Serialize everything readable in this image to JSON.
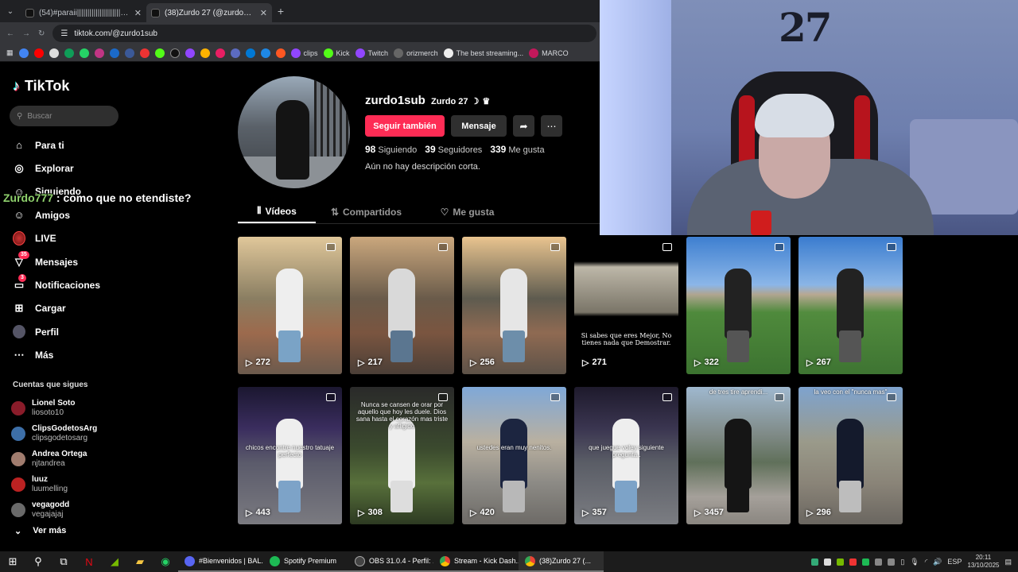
{
  "browser": {
    "tabs": [
      {
        "title": "(54)#paraii||||||||||||||||||||||||||||| #ti",
        "active": false
      },
      {
        "title": "(38)Zurdo 27 (@zurdo1sub",
        "active": true
      }
    ],
    "url": "tiktok.com/@zurdo1sub",
    "bookmarks": [
      "clips",
      "Kick",
      "Twitch",
      "orizmerch",
      "The best streaming...",
      "MARCO"
    ]
  },
  "tiktok": {
    "brand": "TikTok",
    "search_placeholder": "Buscar",
    "nav": [
      {
        "label": "Para ti",
        "icon": "home-icon"
      },
      {
        "label": "Explorar",
        "icon": "compass-icon"
      },
      {
        "label": "Siguiendo",
        "icon": "following-icon"
      },
      {
        "label": "Amigos",
        "icon": "friends-icon"
      },
      {
        "label": "LIVE",
        "icon": "live-icon"
      },
      {
        "label": "Mensajes",
        "icon": "messages-icon",
        "badge": "35"
      },
      {
        "label": "Notificaciones",
        "icon": "inbox-icon",
        "badge": "3"
      },
      {
        "label": "Cargar",
        "icon": "upload-icon"
      },
      {
        "label": "Perfil",
        "icon": "profile-icon"
      },
      {
        "label": "Más",
        "icon": "more-icon"
      }
    ],
    "following_header": "Cuentas que sigues",
    "following": [
      {
        "name": "Lionel Soto",
        "handle": "liosoto10",
        "color": "#8a1c2a"
      },
      {
        "name": "ClipsGodetosArg",
        "handle": "clipsgodetosarg",
        "color": "#3d6fa8"
      },
      {
        "name": "Andrea Ortega",
        "handle": "njtandrea",
        "color": "#a07c6e"
      },
      {
        "name": "luuz",
        "handle": "luumelling",
        "color": "#b22"
      },
      {
        "name": "vegagodd",
        "handle": "vegajajaj",
        "color": "#6a6a6a"
      }
    ],
    "ver_mas": "Ver más"
  },
  "chat_overlay": {
    "user": "Zurdo777",
    "message": " : como que no etendiste?"
  },
  "profile": {
    "username": "zurdo1sub",
    "nickname": "Zurdo 27",
    "follow_label": "Seguir también",
    "message_label": "Mensaje",
    "stats": [
      {
        "value": "98",
        "label": "Siguiendo"
      },
      {
        "value": "39",
        "label": "Seguidores"
      },
      {
        "value": "339",
        "label": "Me gusta"
      }
    ],
    "bio": "Aún no hay descripción corta.",
    "tabs": [
      "Vídeos",
      "Compartidos",
      "Me gusta"
    ]
  },
  "videos": [
    {
      "views": "272",
      "caption": "",
      "bg": "linear-gradient(180deg,#e0c79a 0%,#8a7e62 45%,#9c6a4d 70%,#6b5a4d 100%)",
      "fig": "#eee",
      "legs": "#7aa3c6"
    },
    {
      "views": "217",
      "caption": "",
      "bg": "linear-gradient(180deg,#caa77d 0%,#6a5b4a 45%,#7a5540 70%,#4b3f37 100%)",
      "fig": "#d9d9d9",
      "legs": "#5b7690"
    },
    {
      "views": "256",
      "caption": "",
      "bg": "linear-gradient(180deg,#e9c48f 0%,#5e5b4f 45%,#8f6a52 70%,#5d5248 100%)",
      "fig": "#e6e6e6",
      "legs": "#6d8eaa"
    },
    {
      "views": "271",
      "caption": "Si sabes que eres Mejor, No tienes nada que Demostrar.",
      "bg": "linear-gradient(180deg,#000 0%,#000 18%,#bdb7a8 22%,#7a7568 55%,#000 58%,#000 100%)",
      "fig": "",
      "legs": ""
    },
    {
      "views": "322",
      "caption": "",
      "bg": "linear-gradient(180deg,#3e7fd0 0%,#8bb6e8 35%,#b0a590 42%,#4f8a3c 55%,#3c7330 100%)",
      "fig": "#222",
      "legs": "#555"
    },
    {
      "views": "267",
      "caption": "",
      "bg": "linear-gradient(180deg,#3a7ccf 0%,#8ab5e6 35%,#b8a892 42%,#528c3e 55%,#3e7432 100%)",
      "fig": "#222",
      "legs": "#555"
    },
    {
      "views": "443",
      "caption": "chicos encontre nuestro tatuaje perfecto",
      "bg": "linear-gradient(180deg,#1b1730 0%,#3a2d5e 30%,#5b5b6b 55%,#7a7a80 100%)",
      "fig": "#eee",
      "legs": "#7da3c8"
    },
    {
      "views": "308",
      "caption": "Nunca se cansen de orar por aquello que hoy les duele. Dios sana hasta el corazón mas triste y afligido",
      "bg": "linear-gradient(180deg,#2a2a2a 0%,#3b4a2e 45%,#58703b 70%,#2d3a22 100%)",
      "fig": "#eee",
      "legs": "#ddd"
    },
    {
      "views": "420",
      "caption": "ustedes eran muy nenitos.",
      "bg": "linear-gradient(180deg,#7fa8d8 0%,#b9b0a0 40%,#8c8a85 70%,#6d6a66 100%)",
      "fig": "#1c2540",
      "legs": "#b8b8b8"
    },
    {
      "views": "357",
      "caption": "que juegue voley siguiente pregunta..",
      "bg": "linear-gradient(180deg,#1e1a2c 0%,#3a3550 30%,#5a5d66 55%,#7b7d82 100%)",
      "fig": "#eee",
      "legs": "#7da3c8"
    },
    {
      "views": "3457",
      "caption": "",
      "bg": "linear-gradient(180deg,#9fb8cf 0%,#7f8a86 35%,#60705a 55%,#a5a09a 80%,#8a8680 100%)",
      "fig": "#151515",
      "legs": "#151515"
    },
    {
      "views": "296",
      "caption": "",
      "bg": "linear-gradient(180deg,#7ea3cf 0%,#9a9a8a 40%,#8a8478 70%,#6a6660 100%)",
      "fig": "#141a2c",
      "legs": "#bdbdbd"
    }
  ],
  "video_overlay_texts": [
    "",
    "",
    "",
    "",
    "",
    "",
    "",
    "",
    "",
    "",
    "de tres tire aprendi...",
    "la veo con el \"nunca mas\""
  ],
  "taskbar": {
    "apps": [
      "#Bienvenidos | BAL...",
      "Spotify Premium",
      "OBS 31.0.4 - Perfil: ...",
      "Stream - Kick Dash...",
      "(38)Zurdo 27 (..."
    ],
    "app_colors": [
      "#5865f2",
      "#1db954",
      "#444",
      "#ea4335",
      "#ea4335"
    ],
    "lang": "ESP",
    "time": "20:11",
    "date": "13/10/2025"
  }
}
